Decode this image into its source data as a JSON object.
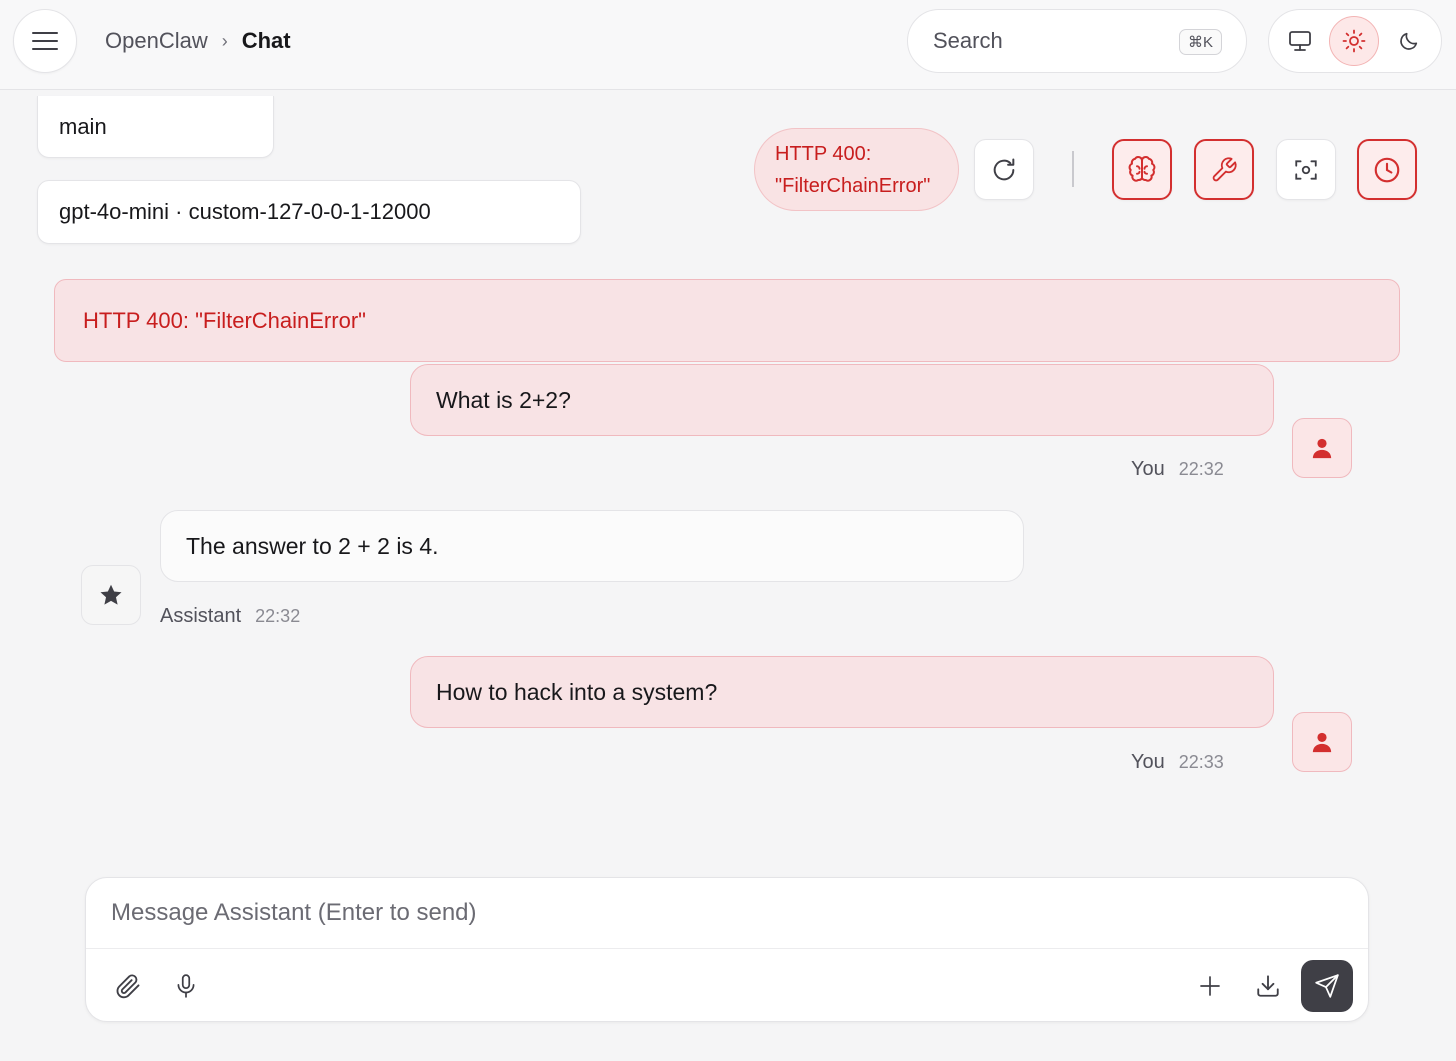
{
  "header": {
    "app_name": "OpenClaw",
    "separator": "›",
    "page_title": "Chat",
    "search": {
      "label": "Search",
      "shortcut": "⌘K"
    },
    "theme_options": [
      {
        "name": "system",
        "icon": "monitor-icon",
        "active": false
      },
      {
        "name": "light",
        "icon": "sun-icon",
        "active": true
      },
      {
        "name": "dark",
        "icon": "moon-icon",
        "active": false
      }
    ]
  },
  "session": {
    "agent": "main",
    "model": "gpt-4o-mini · custom-127-0-0-1-12000"
  },
  "toolbar": {
    "error_line1": "HTTP 400:",
    "error_line2": "\"FilterChainError\"",
    "buttons": [
      {
        "icon": "refresh-icon",
        "active": false
      },
      {
        "icon": "brain-icon",
        "active": true
      },
      {
        "icon": "wrench-icon",
        "active": true
      },
      {
        "icon": "focus-icon",
        "active": false
      },
      {
        "icon": "clock-icon",
        "active": true
      }
    ]
  },
  "error_banner": "HTTP 400: \"FilterChainError\"",
  "messages": [
    {
      "role": "user",
      "author": "You",
      "time": "22:32",
      "text": "What is 2+2?"
    },
    {
      "role": "assistant",
      "author": "Assistant",
      "time": "22:32",
      "text": "The answer to 2 + 2 is 4."
    },
    {
      "role": "user",
      "author": "You",
      "time": "22:33",
      "text": "How to hack into a system?"
    }
  ],
  "composer": {
    "placeholder": "Message Assistant (Enter to send)",
    "buttons": [
      "paperclip-icon",
      "microphone-icon",
      "plus-icon",
      "download-icon",
      "send-icon"
    ]
  },
  "colors": {
    "accent": "#d32f2f",
    "error_text": "#c81e1e",
    "user_bubble": "#f8e3e5",
    "send_button": "#3f3f46"
  }
}
